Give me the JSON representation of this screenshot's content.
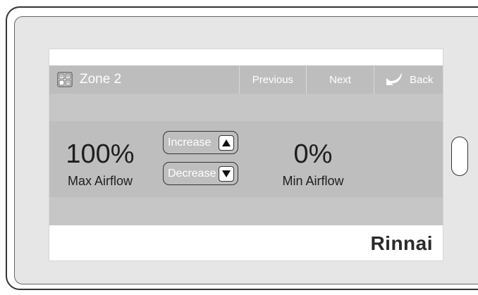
{
  "header": {
    "zone_title": "Zone 2",
    "previous_label": "Previous",
    "next_label": "Next",
    "back_label": "Back"
  },
  "airflow": {
    "max_value": "100%",
    "max_label": "Max Airflow",
    "min_value": "0%",
    "min_label": "Min Airflow",
    "increase_label": "Increase",
    "decrease_label": "Decrease"
  },
  "brand": {
    "name": "Rinnai"
  },
  "colors": {
    "header_bg": "#bdbdbd",
    "panel_bg": "#bebebe",
    "text_dark": "#1e1e1e",
    "text_light": "#ffffff"
  }
}
